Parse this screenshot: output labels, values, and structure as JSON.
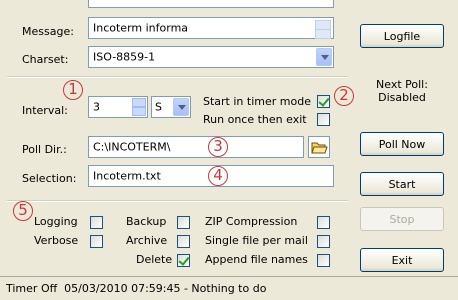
{
  "message": {
    "label": "Message:",
    "value": "Incoterm informa"
  },
  "charset": {
    "label": "Charset:",
    "value": "ISO-8859-1"
  },
  "interval": {
    "label": "Interval:",
    "value": "3",
    "unit": "S"
  },
  "timer_mode": {
    "label": "Start in timer mode",
    "checked": true
  },
  "run_once": {
    "label": "Run once then exit",
    "checked": false
  },
  "poll_dir": {
    "label": "Poll Dir.:",
    "value": "C:\\INCOTERM\\"
  },
  "selection": {
    "label": "Selection:",
    "value": "Incoterm.txt"
  },
  "next_poll": {
    "line1": "Next Poll:",
    "line2": "Disabled"
  },
  "buttons": {
    "logfile": "Logfile",
    "poll_now": "Poll Now",
    "start": "Start",
    "stop": "Stop",
    "exit": "Exit"
  },
  "options": {
    "logging": "Logging",
    "verbose": "Verbose",
    "backup": "Backup",
    "archive": "Archive",
    "delete": "Delete",
    "zip": "ZIP Compression",
    "single_file": "Single file per mail",
    "append_names": "Append file names"
  },
  "callouts": [
    "1",
    "2",
    "3",
    "4",
    "5"
  ],
  "status_bar": "Timer Off  05/03/2010 07:59:45 - Nothing to do",
  "colors": {
    "callout": "#c83a3a",
    "window_bg": "#ece9d8",
    "field_border": "#7f9db9"
  }
}
